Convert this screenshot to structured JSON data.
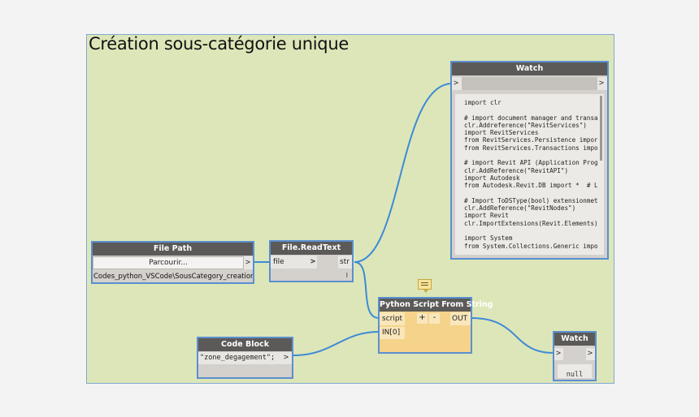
{
  "group": {
    "title": "Création sous-catégorie unique"
  },
  "watch_large": {
    "title": "Watch",
    "in_port": ">",
    "out_port": ">",
    "code_lines": [
      "import clr",
      "",
      "# import document manager and transac",
      "clr.Addreference(\"RevitServices\")",
      "import RevitServices",
      "from RevitServices.Persistence import",
      "from RevitServices.Transactions impor",
      "",
      "# import Revit API (Application Progr",
      "clr.AddReference(\"RevitAPI\")",
      "import Autodesk",
      "from Autodesk.Revit.DB import *  # L",
      "",
      "# Import ToDSType(bool) extensionmeth",
      "clr.AddReference(\"RevitNodes\")",
      "import Revit",
      "clr.ImportExtensions(Revit.Elements)",
      "",
      "import System",
      "from System.Collections.Generic impor"
    ]
  },
  "file_path": {
    "title": "File Path",
    "browse_label": "Parcourir...",
    "out_port": ">",
    "value": "Codes_python_VSCode\\SousCategory_creation.py"
  },
  "file_read": {
    "title": "File.ReadText",
    "in_port": "file",
    "in_chevron": ">",
    "out_port": "str",
    "lacing": "l"
  },
  "python": {
    "title": "Python Script From String",
    "in_script": "script",
    "in_index": "IN[0]",
    "add_label": "+",
    "remove_label": "-",
    "out_port": "OUT"
  },
  "code_block": {
    "title": "Code Block",
    "code": "\"zone_degagement\";",
    "out_port": ">"
  },
  "watch_small": {
    "title": "Watch",
    "in_port": ">",
    "out_port": ">",
    "value": "null"
  },
  "colors": {
    "group_bg": "#dde6b8",
    "node_header": "#5b5a59",
    "node_border": "#5a8fd0",
    "wire": "#3c8ad8",
    "python_body": "#f5d38a"
  }
}
